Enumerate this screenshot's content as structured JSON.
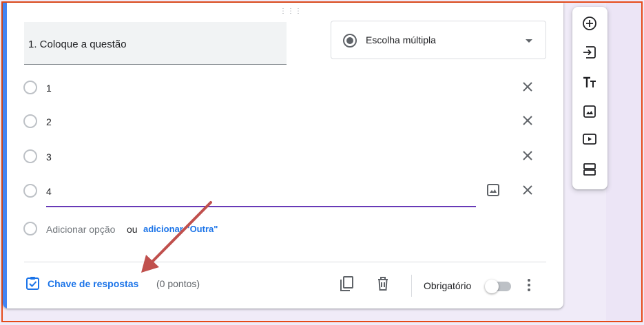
{
  "question": {
    "title": "1. Coloque a questão",
    "type_label": "Escolha múltipla"
  },
  "options": [
    {
      "label": "1"
    },
    {
      "label": "2"
    },
    {
      "label": "3"
    },
    {
      "label": "4"
    }
  ],
  "add_option": {
    "label": "Adicionar opção",
    "or_text": "ou",
    "add_other_label": "adicionar \"Outra\""
  },
  "footer": {
    "answer_key_label": "Chave de respostas",
    "points_label": "(0 pontos)",
    "required_label": "Obrigatório",
    "required_on": false
  },
  "toolbar": {
    "items": [
      "add-question-icon",
      "import-questions-icon",
      "add-title-icon",
      "add-image-icon",
      "add-video-icon",
      "add-section-icon"
    ]
  },
  "colors": {
    "accent": "#4285f4",
    "focus_underline": "#673ab7",
    "link": "#1a73e8",
    "annotation_arrow": "#c0504d",
    "frame": "#e64a19"
  }
}
